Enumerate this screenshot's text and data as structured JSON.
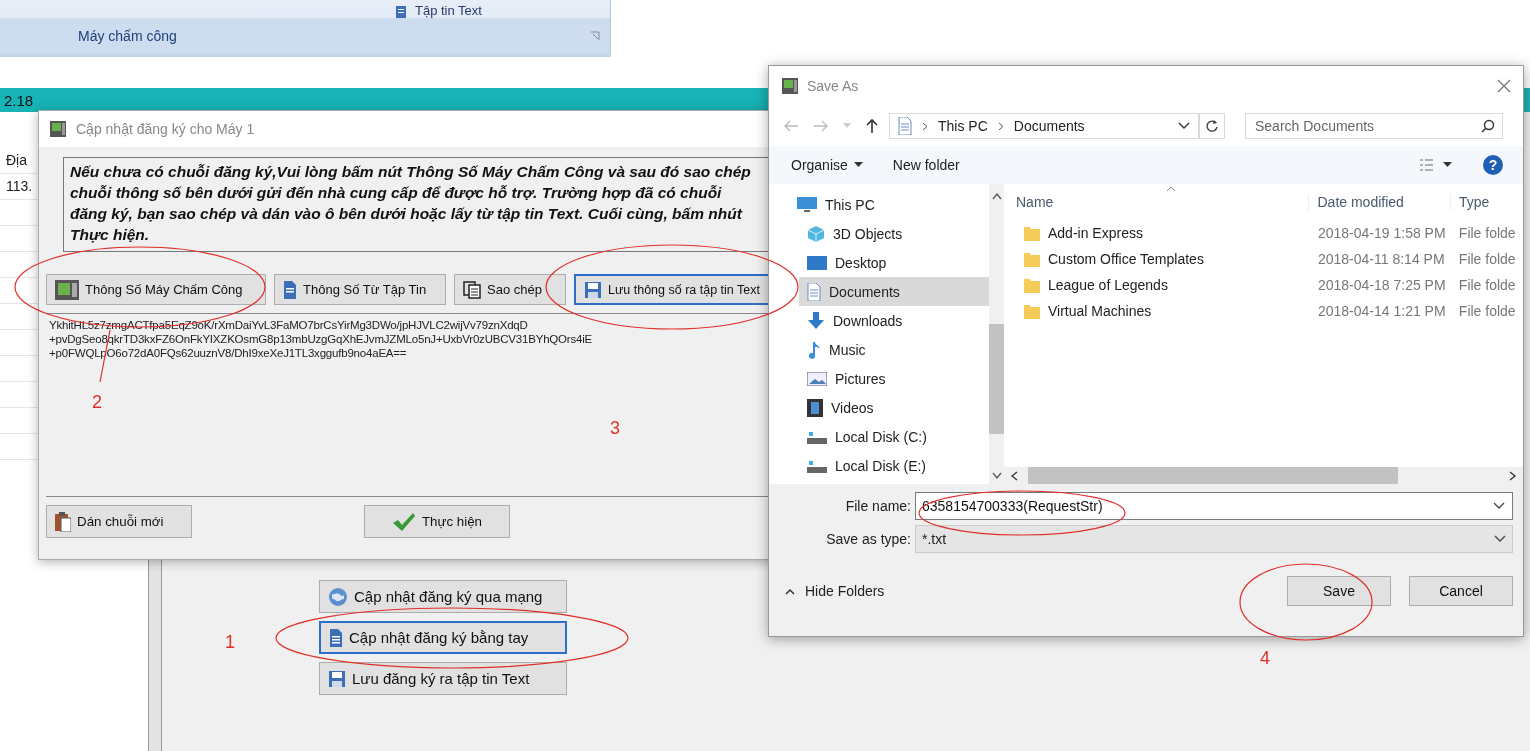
{
  "ribbon": {
    "partial_label": "Tập tin Text",
    "group_label": "Máy chấm công"
  },
  "header_bar": {
    "text": "2.18"
  },
  "left_column": {
    "rows": [
      "Địa",
      "113."
    ]
  },
  "main_buttons": [
    {
      "label": "Cập nhật đăng ký qua mạng",
      "focused": false
    },
    {
      "label": "Cập nhật đăng ký bằng tay",
      "focused": true
    },
    {
      "label": "Lưu đăng ký ra tập tin Text",
      "focused": false
    }
  ],
  "register_dialog": {
    "title": "Cập nhật đăng ký cho Máy 1",
    "instructions": "Nếu chưa có chuỗi đăng ký,Vui lòng bấm nút Thông Số Máy Chấm Công và sau đó sao chép chuỗi thông số bên dưới gửi đến nhà cung cấp để được hỗ trợ. Trường hợp đã có chuỗi đăng ký, bạn sao chép và dán vào ô bên dưới hoặc lấy từ tập tin Text. Cuối cùng, bấm nhút Thực hiện.",
    "buttons": [
      {
        "label": "Thông Số Máy Chấm Công",
        "focused": false
      },
      {
        "label": "Thông Số Từ Tập Tin",
        "focused": false
      },
      {
        "label": "Sao chép",
        "focused": false
      },
      {
        "label": "Lưu thông số ra tập tin Text",
        "focused": true
      }
    ],
    "request_lines": [
      "YkhitHL5z7zmgACTfpa5EqZ9oK/rXmDaiYvL3FaMO7brCsYirMg3DWo/jpHJVLC2wijVv79znXdqD",
      "+pvDgSeo8qkrTD3kxFZ6OnFkYIXZKOsmG8p13mbUzgGqXhEJvmJZMLo5nJ+UxbVr0zUBCV31BYhQOrs4iE",
      "+p0FWQLpO6o72dA0FQs62uuznV8/DhI9xeXeJ1TL3xggufb9no4aEA=="
    ],
    "bottom_buttons": [
      {
        "label": "Dán chuỗi mới",
        "focused": false
      },
      {
        "label": "Thực hiện",
        "focused": false
      }
    ]
  },
  "save_dialog": {
    "title": "Save As",
    "breadcrumb": [
      "This PC",
      "Documents"
    ],
    "search": {
      "placeholder": "Search Documents"
    },
    "toolbar": [
      "Organise",
      "New folder"
    ],
    "help_label": "?",
    "nav_items": [
      {
        "label": "This PC",
        "selected": false
      },
      {
        "label": "3D Objects",
        "selected": false
      },
      {
        "label": "Desktop",
        "selected": false
      },
      {
        "label": "Documents",
        "selected": true
      },
      {
        "label": "Downloads",
        "selected": false
      },
      {
        "label": "Music",
        "selected": false
      },
      {
        "label": "Pictures",
        "selected": false
      },
      {
        "label": "Videos",
        "selected": false
      },
      {
        "label": "Local Disk (C:)",
        "selected": false
      },
      {
        "label": "Local Disk (E:)",
        "selected": false
      }
    ],
    "columns": [
      "Name",
      "Date modified",
      "Type"
    ],
    "rows": [
      {
        "name": "Add-in Express",
        "date": "2018-04-19 1:58 PM",
        "type": "File folde"
      },
      {
        "name": "Custom Office Templates",
        "date": "2018-04-11 8:14 PM",
        "type": "File folde"
      },
      {
        "name": "League of Legends",
        "date": "2018-04-18 7:25 PM",
        "type": "File folde"
      },
      {
        "name": "Virtual Machines",
        "date": "2018-04-14 1:21 PM",
        "type": "File folde"
      }
    ],
    "file_name_label": "File name:",
    "file_name": "6358154700333(RequestStr)",
    "type_label": "Save as type:",
    "save_type": "*.txt",
    "hide_folders": "Hide Folders",
    "buttons": [
      "Save",
      "Cancel"
    ]
  },
  "annotations": [
    "2",
    "3",
    "1",
    "4"
  ]
}
